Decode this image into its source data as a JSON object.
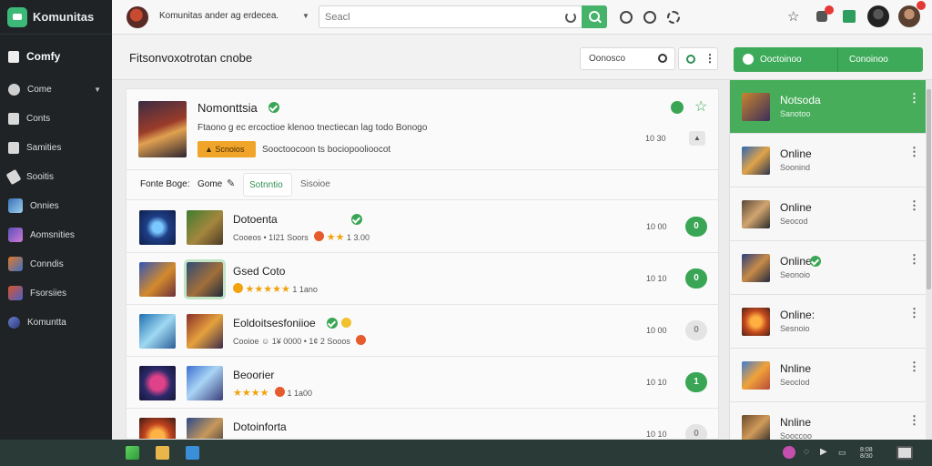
{
  "app": {
    "name": "Komunitas",
    "colors": {
      "accent": "#3daa5a",
      "sidebar": "#1f2326",
      "taskbar": "#2a3b37",
      "star": "#f2a20e"
    }
  },
  "sidebar": {
    "items": [
      {
        "label": "Comfy",
        "icon": "home-icon"
      },
      {
        "label": "Come",
        "icon": "user-circle-icon"
      },
      {
        "label": "Conts",
        "icon": "document-icon"
      },
      {
        "label": "Samities",
        "icon": "list-icon"
      },
      {
        "label": "Sooitis",
        "icon": "pencil-icon"
      },
      {
        "label": "Onnies",
        "icon": "game-art-icon"
      },
      {
        "label": "Aomsnities",
        "icon": "game-art-icon"
      },
      {
        "label": "Conndis",
        "icon": "game-art-icon"
      },
      {
        "label": "Fsorsiies",
        "icon": "game-art-icon"
      },
      {
        "label": "Komuntta",
        "icon": "game-art-icon"
      }
    ]
  },
  "topbar": {
    "title": "Komunitas ander ag erdecea.",
    "search_placeholder": "Seacl"
  },
  "pagehead": {
    "title": "Fitsonvoxotrotan cnobe",
    "search_label": "Oonosco",
    "primary_left": "Ooctoinoo",
    "primary_right": "Conoinoo"
  },
  "hero": {
    "name": "Nomonttsia",
    "description": "Ftaono g ec ercoctioe klenoo tnectiecan lag todo Bonogo",
    "tag": "Scnoios",
    "meta": "Sooctoocoon ts bociopoolioocot",
    "count": "10 30"
  },
  "filter": {
    "label": "Fonte Boge:",
    "value": "Gome",
    "tab_active": "Sotnntio",
    "tab_other": "Sisoioe"
  },
  "rows": [
    {
      "title": "Dotoenta",
      "sub": "Cooeos • 1I21 Soors",
      "rating": "1 3.00",
      "stars": "★★",
      "count": "10 00",
      "button": "0",
      "enabled": true
    },
    {
      "title": "Gsed Coto",
      "sub": "",
      "rating": "1 1ano",
      "stars": "★★★★★",
      "count": "10 10",
      "button": "0",
      "enabled": true
    },
    {
      "title": "Eoldoitsesfoniioe",
      "sub": "Cooioe ☺ 1¥ 0000 • 1¢ 2 Sooos",
      "rating": "",
      "stars": "",
      "count": "10 00",
      "button": "0",
      "enabled": false
    },
    {
      "title": "Beoorier",
      "sub": "",
      "rating": "1 1a00",
      "stars": "★★★★",
      "count": "10 10",
      "button": "1",
      "enabled": true
    },
    {
      "title": "Dotoinforta",
      "sub": "",
      "rating": "",
      "stars": "",
      "count": "10 10",
      "button": "0",
      "enabled": false
    }
  ],
  "online_panel": [
    {
      "name": "Notsoda",
      "sub": "Sanotoo",
      "active": true
    },
    {
      "name": "Online",
      "sub": "Soonind",
      "active": false
    },
    {
      "name": "Online",
      "sub": "Seocod",
      "active": false
    },
    {
      "name": "Online",
      "sub": "Seonoio",
      "active": false,
      "verified": true
    },
    {
      "name": "Online:",
      "sub": "Sesnoio",
      "active": false
    },
    {
      "name": "Nnline",
      "sub": "Seoclod",
      "active": false
    },
    {
      "name": "Nnline",
      "sub": "Sooccoo",
      "active": false
    }
  ],
  "taskbar": {
    "time": "8:08",
    "date": "8/30"
  }
}
